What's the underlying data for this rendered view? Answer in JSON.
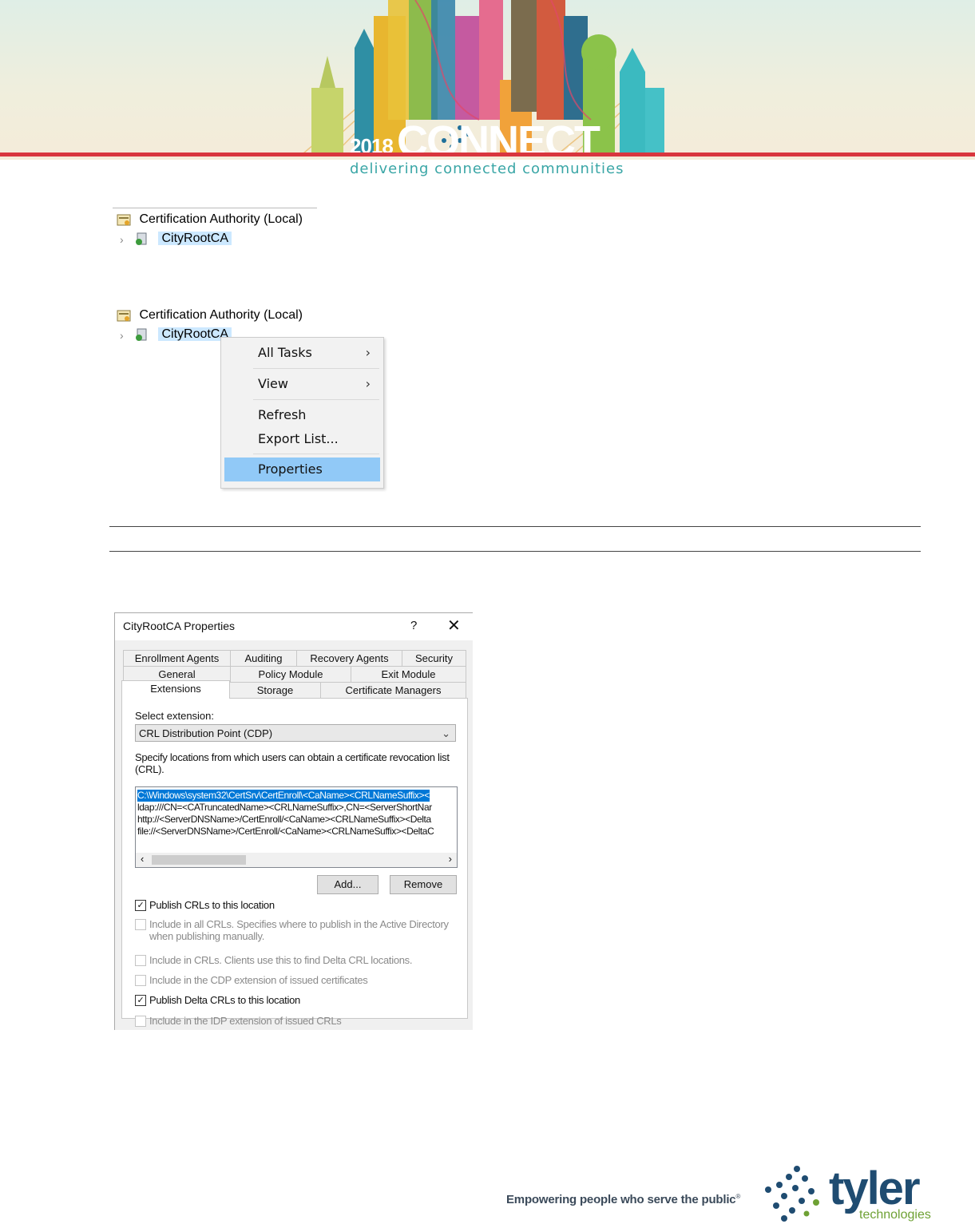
{
  "banner": {
    "year": "2018",
    "connect": "CONNECT",
    "tagline": "delivering connected communities"
  },
  "tree1": {
    "root": "Certification Authority (Local)",
    "node": "CityRootCA"
  },
  "tree2": {
    "root": "Certification Authority (Local)",
    "node": "CityRootCA"
  },
  "context_menu": {
    "items": [
      {
        "label": "All Tasks",
        "arrow": "›"
      },
      {
        "label": "View",
        "arrow": "›"
      },
      {
        "label": "Refresh"
      },
      {
        "label": "Export List..."
      },
      {
        "label": "Properties"
      }
    ]
  },
  "dialog": {
    "title": "CityRootCA Properties",
    "help": "?",
    "close": "✕",
    "tabs_row1": [
      "Enrollment Agents",
      "Auditing",
      "Recovery Agents",
      "Security"
    ],
    "tabs_row2": [
      "General",
      "Policy Module",
      "Exit Module"
    ],
    "tabs_row3": [
      "Extensions",
      "Storage",
      "Certificate Managers"
    ],
    "select_label": "Select extension:",
    "selected_extension": "CRL Distribution Point (CDP)",
    "desc": "Specify locations from which users can obtain a certificate revocation list (CRL).",
    "locations": [
      "C:\\Windows\\system32\\CertSrv\\CertEnroll\\<CaName><CRLNameSuffix><",
      "ldap:///CN=<CATruncatedName><CRLNameSuffix>,CN=<ServerShortNar",
      "http://<ServerDNSName>/CertEnroll/<CaName><CRLNameSuffix><Delta",
      "file://<ServerDNSName>/CertEnroll/<CaName><CRLNameSuffix><DeltaC"
    ],
    "add_button": "Add...",
    "remove_button": "Remove",
    "options": [
      {
        "label": "Publish CRLs to this location",
        "checked": true,
        "enabled": true
      },
      {
        "label": "Include in all CRLs. Specifies where to publish in the Active Directory when publishing manually.",
        "checked": false,
        "enabled": false
      },
      {
        "label": "Include in CRLs. Clients use this to find Delta CRL locations.",
        "checked": false,
        "enabled": false
      },
      {
        "label": "Include in the CDP extension of issued certificates",
        "checked": false,
        "enabled": false
      },
      {
        "label": "Publish Delta CRLs to this location",
        "checked": true,
        "enabled": true
      },
      {
        "label": "Include in the IDP extension of issued CRLs",
        "checked": false,
        "enabled": false
      }
    ]
  },
  "footer": {
    "slogan": "Empowering people who serve the public",
    "reg": "®",
    "brand": "tyler",
    "sub": "technologies"
  },
  "colors": {
    "accent_red": "#d9363e",
    "menu_highlight": "#91c9f7",
    "tree_selection": "#cce8ff",
    "list_selection": "#0078d7",
    "tyler_blue": "#1f4c71",
    "tyler_green": "#6ea134"
  }
}
